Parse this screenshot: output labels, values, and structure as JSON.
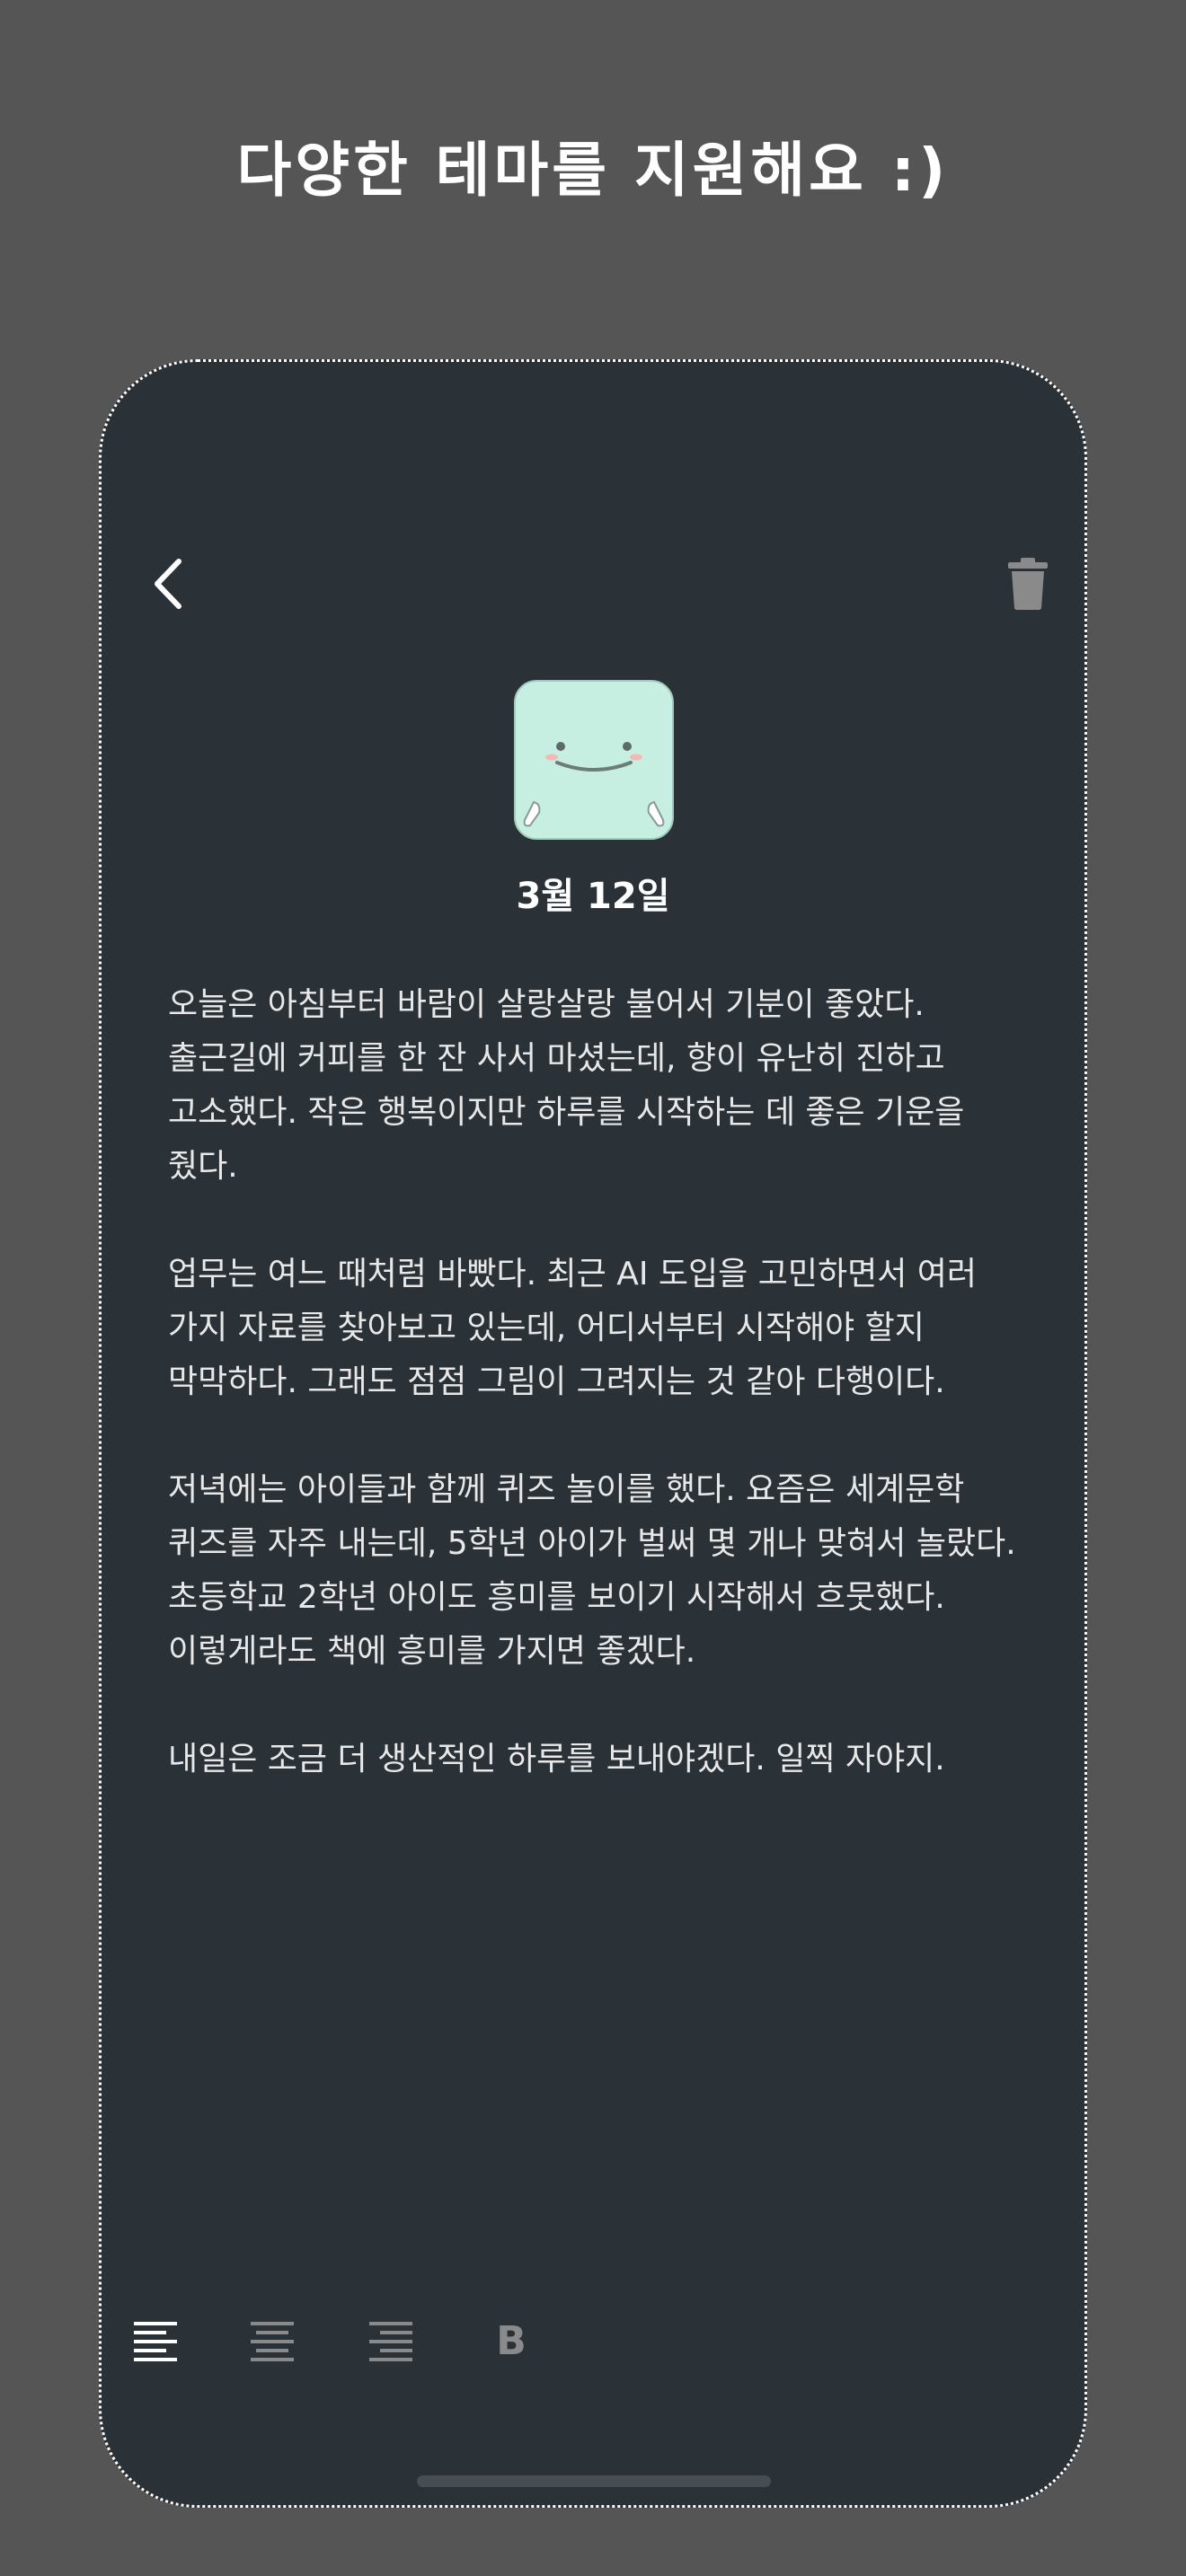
{
  "promo": {
    "title": "다양한 테마를 지원해요 :)"
  },
  "header": {
    "back_icon": "chevron-left-icon",
    "delete_icon": "trash-icon"
  },
  "entry": {
    "mood_icon": "smiling-mint-face-icon",
    "date": "3월 12일",
    "paragraphs": [
      "오늘은 아침부터 바람이 살랑살랑 불어서 기분이 좋았다. 출근길에 커피를 한 잔 사서 마셨는데, 향이 유난히 진하고 고소했다. 작은 행복이지만 하루를 시작하는 데 좋은 기운을 줬다.",
      "업무는 여느 때처럼 바빴다. 최근 AI 도입을 고민하면서 여러 가지 자료를 찾아보고 있는데, 어디서부터 시작해야 할지 막막하다. 그래도 점점 그림이 그려지는 것 같아 다행이다.",
      "저녁에는 아이들과 함께 퀴즈 놀이를 했다. 요즘은 세계문학 퀴즈를 자주 내는데, 5학년 아이가 벌써 몇 개나 맞혀서 놀랐다. 초등학교 2학년 아이도 흥미를 보이기 시작해서 흐뭇했다. 이렇게라도 책에 흥미를 가지면 좋겠다.",
      "내일은 조금 더 생산적인 하루를 보내야겠다. 일찍 자야지."
    ]
  },
  "toolbar": {
    "align_left_icon": "align-left-icon",
    "align_center_icon": "align-center-icon",
    "align_right_icon": "align-right-icon",
    "bold_label": "B",
    "active": "align-left"
  },
  "colors": {
    "page_background": "#555555",
    "screen_background": "#2a3137",
    "text_primary": "#ffffff",
    "text_body": "#e8e8e8",
    "icon_muted": "#8a8a8a",
    "mood_mint": "#c6efe2"
  }
}
